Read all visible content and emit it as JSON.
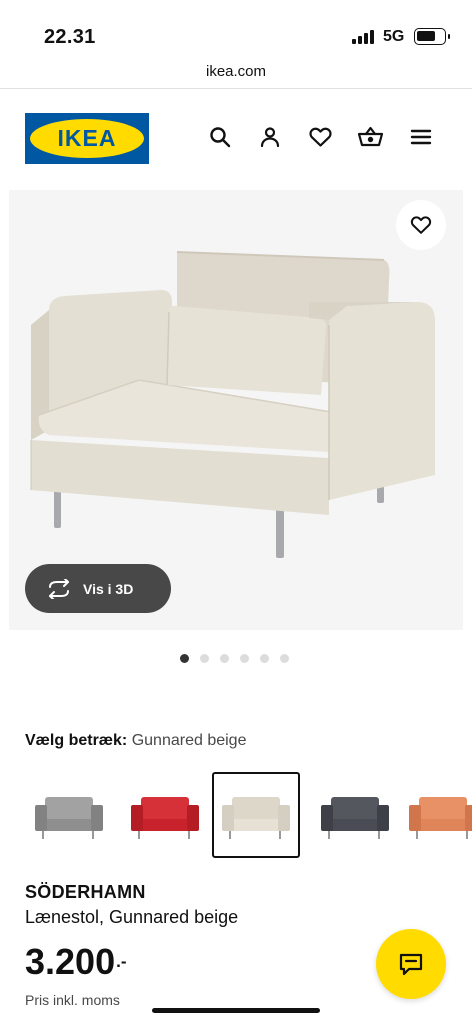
{
  "status_bar": {
    "time": "22.31",
    "network": "5G"
  },
  "browser": {
    "url": "ikea.com"
  },
  "header": {
    "logo_text": "IKEA",
    "icons": [
      "search-icon",
      "account-icon",
      "heart-icon",
      "basket-icon",
      "menu-icon"
    ]
  },
  "product_image": {
    "view_3d_label": "Vis i 3D",
    "carousel": {
      "total": 6,
      "active": 1
    }
  },
  "cover": {
    "label": "Vælg betræk:",
    "value": "Gunnared beige",
    "swatches": [
      {
        "color": "#8f8f8f",
        "selected": false
      },
      {
        "color": "#c8232c",
        "selected": false
      },
      {
        "color": "#e6e1d4",
        "selected": true
      },
      {
        "color": "#4a4c55",
        "selected": false
      },
      {
        "color": "#e0845a",
        "selected": false
      }
    ]
  },
  "product": {
    "name": "SÖDERHAMN",
    "description": "Lænestol, Gunnared beige",
    "price_integer": "3.200",
    "price_suffix": ".-",
    "price_note": "Pris inkl. moms"
  },
  "colors": {
    "brand_blue": "#0058a3",
    "brand_yellow": "#ffdb00",
    "dark_button": "#484848"
  }
}
